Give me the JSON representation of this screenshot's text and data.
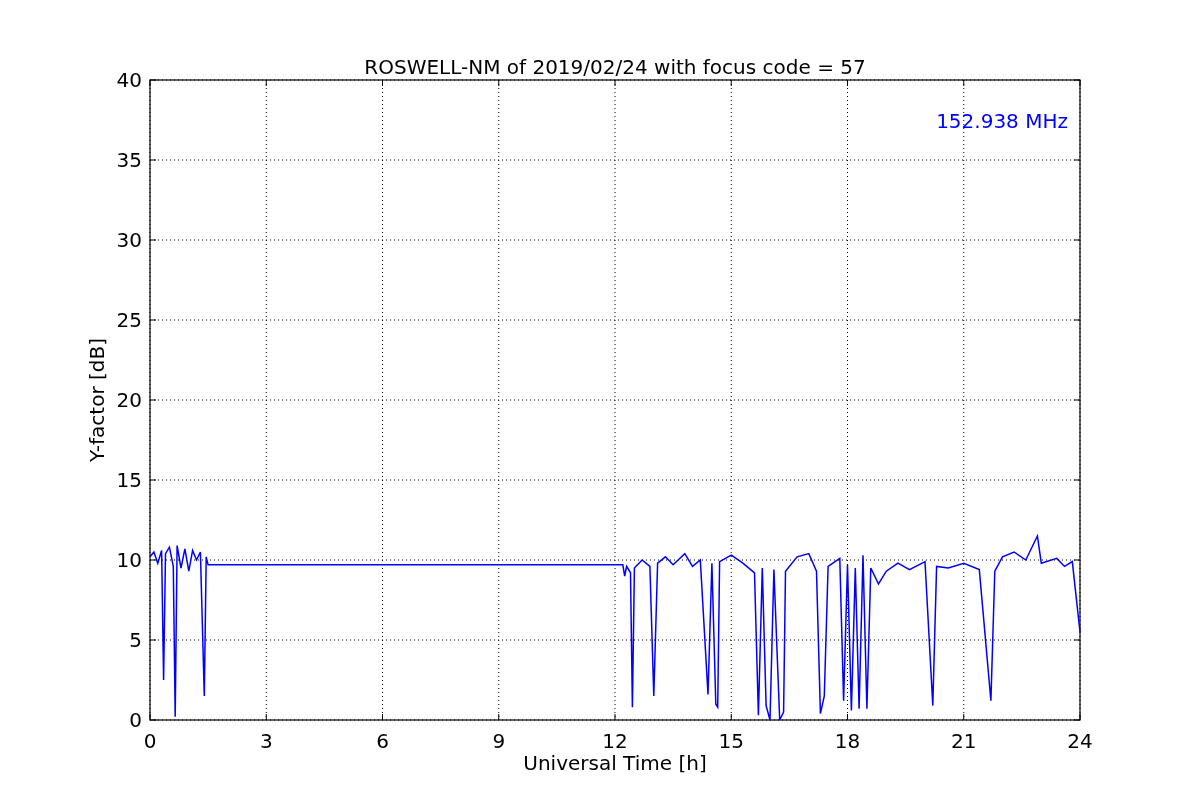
{
  "chart_data": {
    "type": "line",
    "title": "ROSWELL-NM of 2019/02/24 with focus code = 57",
    "xlabel": "Universal Time [h]",
    "ylabel": "Y-factor [dB]",
    "xlim": [
      0,
      24
    ],
    "ylim": [
      0,
      40
    ],
    "xticks": [
      0,
      3,
      6,
      9,
      12,
      15,
      18,
      21,
      24
    ],
    "yticks": [
      0,
      5,
      10,
      15,
      20,
      25,
      30,
      35,
      40
    ],
    "x": [
      0,
      0.1,
      0.2,
      0.3,
      0.35,
      0.4,
      0.5,
      0.6,
      0.65,
      0.7,
      0.8,
      0.9,
      1.0,
      1.1,
      1.2,
      1.3,
      1.4,
      1.45,
      1.5,
      12.2,
      12.25,
      12.3,
      12.4,
      12.45,
      12.5,
      12.7,
      12.9,
      13.0,
      13.1,
      13.3,
      13.5,
      13.8,
      14.0,
      14.2,
      14.4,
      14.5,
      14.6,
      14.65,
      14.7,
      15.0,
      15.3,
      15.6,
      15.7,
      15.8,
      15.9,
      16.0,
      16.1,
      16.25,
      16.35,
      16.4,
      16.7,
      17.0,
      17.2,
      17.3,
      17.4,
      17.5,
      17.8,
      17.9,
      18.0,
      18.1,
      18.2,
      18.3,
      18.4,
      18.5,
      18.6,
      18.8,
      19.0,
      19.3,
      19.6,
      20.0,
      20.2,
      20.3,
      20.6,
      21.0,
      21.4,
      21.7,
      21.8,
      22.0,
      22.3,
      22.6,
      22.9,
      23.0,
      23.4,
      23.6,
      23.8,
      24.0
    ],
    "series": [
      {
        "name": "152.938 MHz",
        "color": "#0000ff",
        "values": [
          10.2,
          10.5,
          9.8,
          10.6,
          2.5,
          10.4,
          10.8,
          9.6,
          0.2,
          10.9,
          9.5,
          10.7,
          9.3,
          10.6,
          10.0,
          10.5,
          1.5,
          10.2,
          9.7,
          9.7,
          9.0,
          9.6,
          9.2,
          0.8,
          9.5,
          10.0,
          9.6,
          1.5,
          9.8,
          10.2,
          9.7,
          10.4,
          9.6,
          10.0,
          1.6,
          9.8,
          1.0,
          0.8,
          9.9,
          10.3,
          9.8,
          9.2,
          0.3,
          9.5,
          0.9,
          0.0,
          9.4,
          0.0,
          0.5,
          9.3,
          10.2,
          10.4,
          9.3,
          0.4,
          1.5,
          9.6,
          10.1,
          1.2,
          9.7,
          0.6,
          9.5,
          0.7,
          10.3,
          0.7,
          9.5,
          8.5,
          9.3,
          9.8,
          9.4,
          9.9,
          0.9,
          9.6,
          9.5,
          9.8,
          9.4,
          1.2,
          9.3,
          10.2,
          10.5,
          10.0,
          11.5,
          9.8,
          10.1,
          9.6,
          9.9,
          5.5
        ]
      }
    ],
    "grid": true
  }
}
